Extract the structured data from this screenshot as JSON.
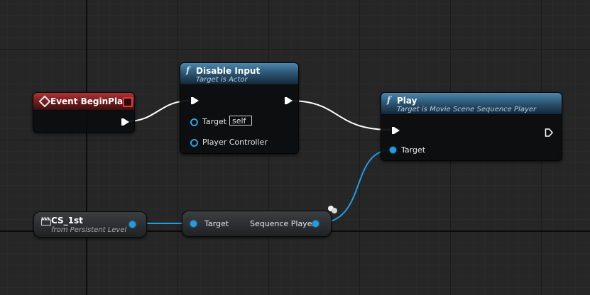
{
  "colors": {
    "background": "#262626",
    "function_header": "#2f5d7d",
    "event_header": "#7c1f20",
    "object_pin": "#1e9ee6",
    "exec_wire": "#ffffff"
  },
  "event_node": {
    "title": "Event BeginPlay",
    "icon": "event-diamond-icon"
  },
  "disable_input_node": {
    "func_glyph": "f",
    "title": "Disable Input",
    "subtitle": "Target is Actor",
    "target_label": "Target",
    "target_value": "self",
    "player_controller_label": "Player Controller"
  },
  "play_node": {
    "func_glyph": "f",
    "title": "Play",
    "subtitle": "Target is Movie Scene Sequence Player",
    "target_label": "Target"
  },
  "actor_ref_node": {
    "icon": "clapperboard-icon",
    "title": "CS_1st",
    "subtitle": "from Persistent Level"
  },
  "getter_node": {
    "target_label": "Target",
    "output_label": "Sequence Player"
  }
}
